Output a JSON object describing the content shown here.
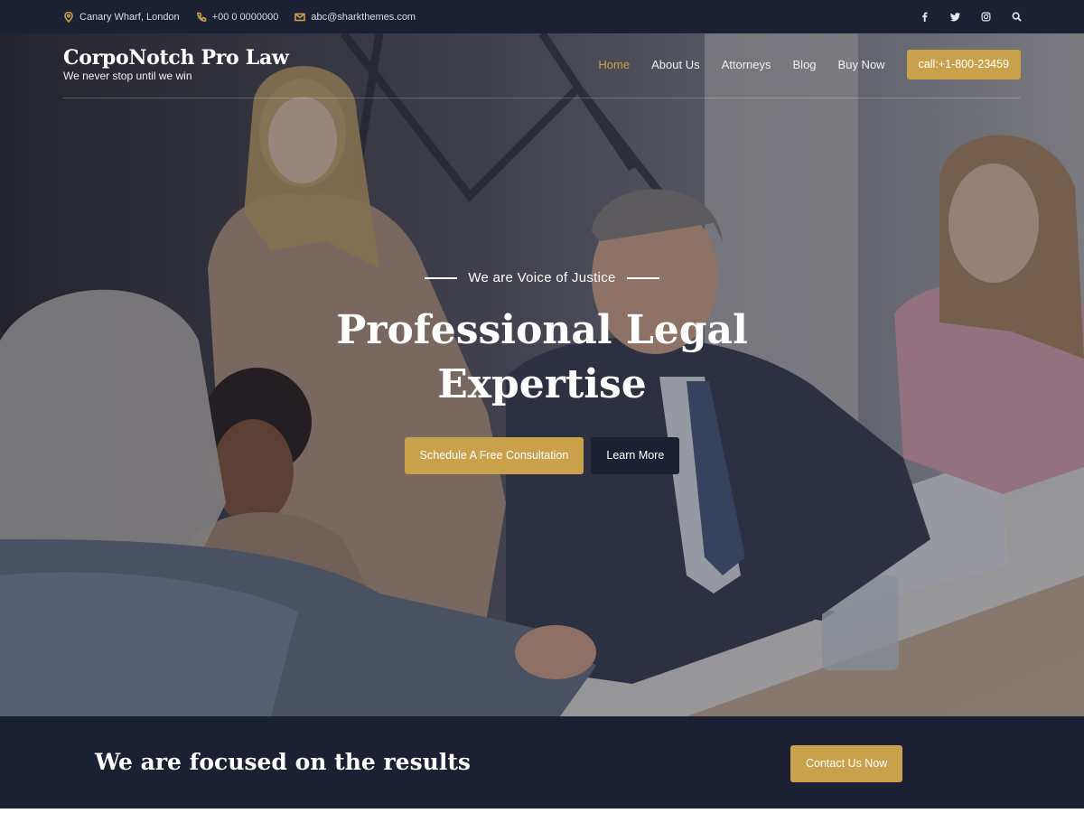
{
  "topbar": {
    "address": "Canary Wharf, London",
    "phone": "+00 0 0000000",
    "email": "abc@sharkthemes.com",
    "social_icons": [
      "facebook-icon",
      "twitter-icon",
      "instagram-icon",
      "search-icon"
    ]
  },
  "header": {
    "site_title": "CorpoNotch Pro Law",
    "tagline": "We never stop until we win",
    "nav": [
      {
        "label": "Home",
        "active": true
      },
      {
        "label": "About Us",
        "active": false
      },
      {
        "label": "Attorneys",
        "active": false
      },
      {
        "label": "Blog",
        "active": false
      },
      {
        "label": "Buy Now",
        "active": false
      }
    ],
    "call_button": "call:+1-800-23459"
  },
  "hero": {
    "eyebrow": "We are Voice of Justice",
    "headline": "Professional Legal Expertise",
    "primary_button": "Schedule A Free Consultation",
    "secondary_button": "Learn More"
  },
  "band": {
    "title": "We are focused on the results",
    "button": "Contact Us Now"
  },
  "colors": {
    "navy": "#1c2033",
    "gold": "#c9a14a",
    "white": "#ffffff"
  }
}
